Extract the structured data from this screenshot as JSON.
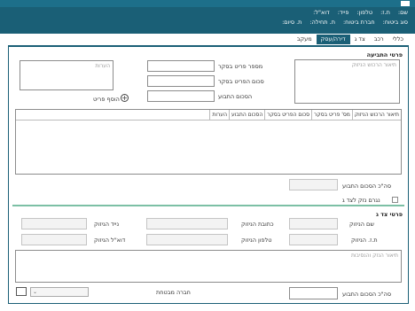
{
  "header": {
    "row1": [
      "שם:",
      "ת.ז:",
      "טלפון:",
      "פייד:",
      "דוא\"ל:"
    ],
    "row2": [
      "סוג ביטוח:",
      "חברת ביטוח:",
      "ת. תחילה:",
      "ת. סיום:"
    ]
  },
  "tabs": [
    "כללי",
    "רכב",
    "צד ג",
    "דירה/עסק",
    "מעקב"
  ],
  "active_tab": "דירה/עסק",
  "event": {
    "section_title": "פרטי התביעה",
    "description_placeholder": "תיאור הרכוש הניזוק",
    "notes_placeholder": "הערות",
    "field_labels": {
      "item_number": "מספר פריט בסקר",
      "item_sum": "סכום הפריט בסקר",
      "claim_sum": "הסכום התבוע"
    },
    "add_item": "הוסף פריט",
    "table_headers": [
      "תיאור הרכוש הניזוק",
      "מס' פריט בסקר",
      "סכום הפריט בסקר",
      "הסכום התבוע",
      "הערות"
    ],
    "total_label": "סה\"כ הסכום התבוע",
    "third_party_check": "נגרם נזק לצד ג"
  },
  "third_party": {
    "section_title": "פרטי צד ג",
    "labels": {
      "name": "שם הניזוק",
      "address": "כתובת הניזוק",
      "mobile": "נייד הניזוק",
      "id": "ת.ז. הניזוק",
      "phone": "טלפון הניזוק",
      "email": "דוא\"ל הניזוק"
    },
    "damage_placeholder": "תיאור הנזק והנסיבות",
    "total_label": "סה\"כ הסכום התבוע",
    "insurer_label": "חברה מבטחת",
    "insurer_value": ""
  },
  "icons": [
    "plus-circle-icon",
    "calendar-icon",
    "dropdown-caret-icon",
    "checkbox-icon"
  ]
}
